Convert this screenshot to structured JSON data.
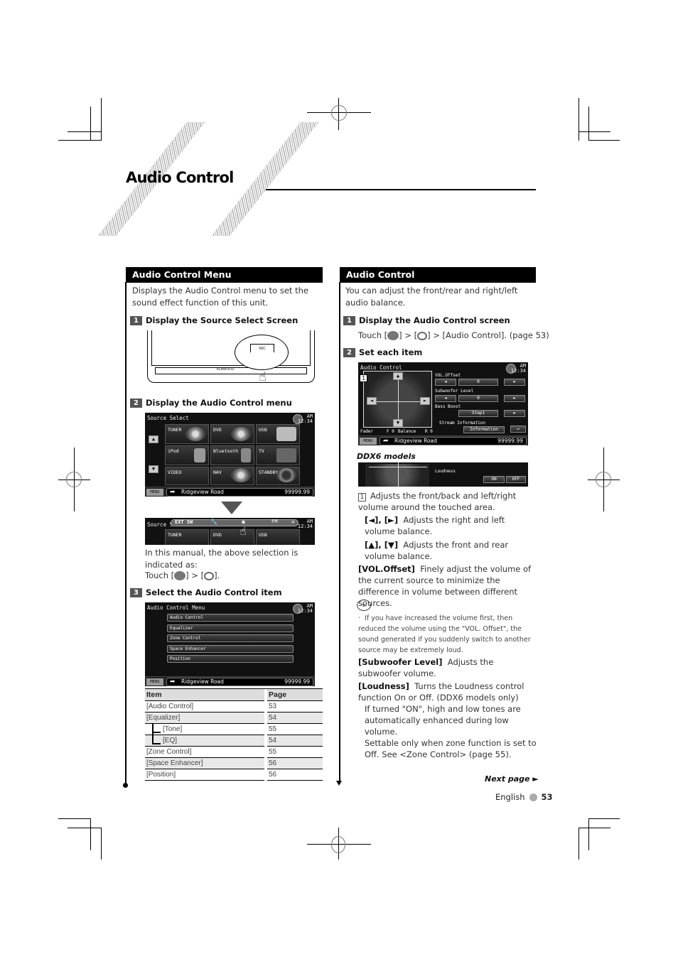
{
  "page": {
    "title": "Audio Control",
    "footer": {
      "next_page": "Next page ►",
      "language": "English",
      "page_number": "53"
    }
  },
  "left": {
    "heading": "Audio Control Menu",
    "intro": "Displays the Audio Control menu to set the sound effect function of this unit.",
    "steps": [
      {
        "num": "1",
        "label": "Display the Source Select Screen"
      },
      {
        "num": "2",
        "label": "Display the Audio Control menu"
      },
      {
        "num": "3",
        "label": "Select the Audio Control item"
      }
    ],
    "device": {
      "src_label": "SRC",
      "brand": "KENWOOD"
    },
    "source_select": {
      "title": "Source Select",
      "clock_ampm": "AM",
      "clock_time": "12:34",
      "tiles": [
        "TUNER",
        "DVD",
        "USB",
        "iPod",
        "Bluetooth",
        "TV",
        "VIDEO",
        "NAV",
        "STANDBY"
      ],
      "menu_label": "MENU",
      "road": "Ridgeview Road",
      "distance": "99999.99"
    },
    "source_strip": {
      "title": "Source S",
      "items": [
        "EXT SW",
        "wrench",
        "audio",
        "FM",
        "close"
      ],
      "tiles": [
        "TUNER",
        "DVD",
        "USB"
      ]
    },
    "indicated_text": "In this manual, the above selection is indicated as:",
    "touch_prefix": "Touch [",
    "touch_mid": "] > [",
    "touch_suffix": "].",
    "audio_menu": {
      "title": "Audio Control Menu",
      "items": [
        "Audio Control",
        "Equalizer",
        "Zone Control",
        "Space Enhancer",
        "Position"
      ],
      "menu_label": "MENU",
      "road": "Ridgeview Road",
      "distance": "99999.99",
      "clock_ampm": "AM",
      "clock_time": "12:34"
    },
    "table": {
      "headers": [
        "Item",
        "Page"
      ],
      "rows": [
        {
          "item": "[Audio Control]",
          "page": "53",
          "sub": false
        },
        {
          "item": "[Equalizer]",
          "page": "54",
          "sub": false
        },
        {
          "item": "[Tone]",
          "page": "55",
          "sub": true
        },
        {
          "item": "[EQ]",
          "page": "54",
          "sub": true
        },
        {
          "item": "[Zone Control]",
          "page": "55",
          "sub": false
        },
        {
          "item": "[Space Enhancer]",
          "page": "56",
          "sub": false
        },
        {
          "item": "[Position]",
          "page": "56",
          "sub": false
        }
      ]
    }
  },
  "right": {
    "heading": "Audio Control",
    "intro": "You can adjust the front/rear and right/left audio balance.",
    "steps": [
      {
        "num": "1",
        "label": "Display the Audio Control screen"
      },
      {
        "num": "2",
        "label": "Set each item"
      }
    ],
    "step1_text": {
      "prefix": "Touch [",
      "mid": "] > [",
      "suffix": "] > [Audio Control]. (page 53)"
    },
    "ac_screen": {
      "title": "Audio Control",
      "marker": "1",
      "vol_offset": "VOL.Offset",
      "vol_value": "0",
      "subwoofer": "Subwoofer Level",
      "sub_value": "0",
      "bass_boost": "Bass Boost",
      "bass_value": "Step1",
      "stream_info": "Stream Information",
      "info_btn": "Information",
      "fader_label": "Fader",
      "fader_value": "F 0",
      "balance_label": "Balance",
      "balance_value": "R 0",
      "menu_label": "MENU",
      "road": "Ridgeview Road",
      "distance": "99999.99",
      "clock_ampm": "AM",
      "clock_time": "12:34"
    },
    "ddx6_label": "DDX6 models",
    "ddx6_screen": {
      "loudness": "Loudness",
      "on": "ON",
      "off": "OFF"
    },
    "descriptions": [
      {
        "key": "1",
        "text": "Adjusts the front/back and left/right volume around the touched area."
      },
      {
        "key": "[◄], [►]",
        "text": "Adjusts the right and left volume balance."
      },
      {
        "key": "[▲], [▼]",
        "text": "Adjusts the front and rear volume balance."
      },
      {
        "key": "[VOL.Offset]",
        "text": "Finely adjust the volume of the current source to minimize the difference in volume between different sources."
      }
    ],
    "note": "If you have increased the volume first, then reduced the volume using the \"VOL. Offset\", the sound generated if you suddenly switch to another source may be extremely loud.",
    "subwoofer_desc": {
      "key": "[Subwoofer Level]",
      "text": "Adjusts the subwoofer volume."
    },
    "loudness_desc": {
      "key": "[Loudness]",
      "lines": [
        "Turns the Loudness control function On or Off. (DDX6 models only)",
        "If turned \"ON\", high and low tones are automatically enhanced during low volume.",
        "Settable only when zone function is set to Off. See <Zone Control> (page 55)."
      ]
    }
  }
}
